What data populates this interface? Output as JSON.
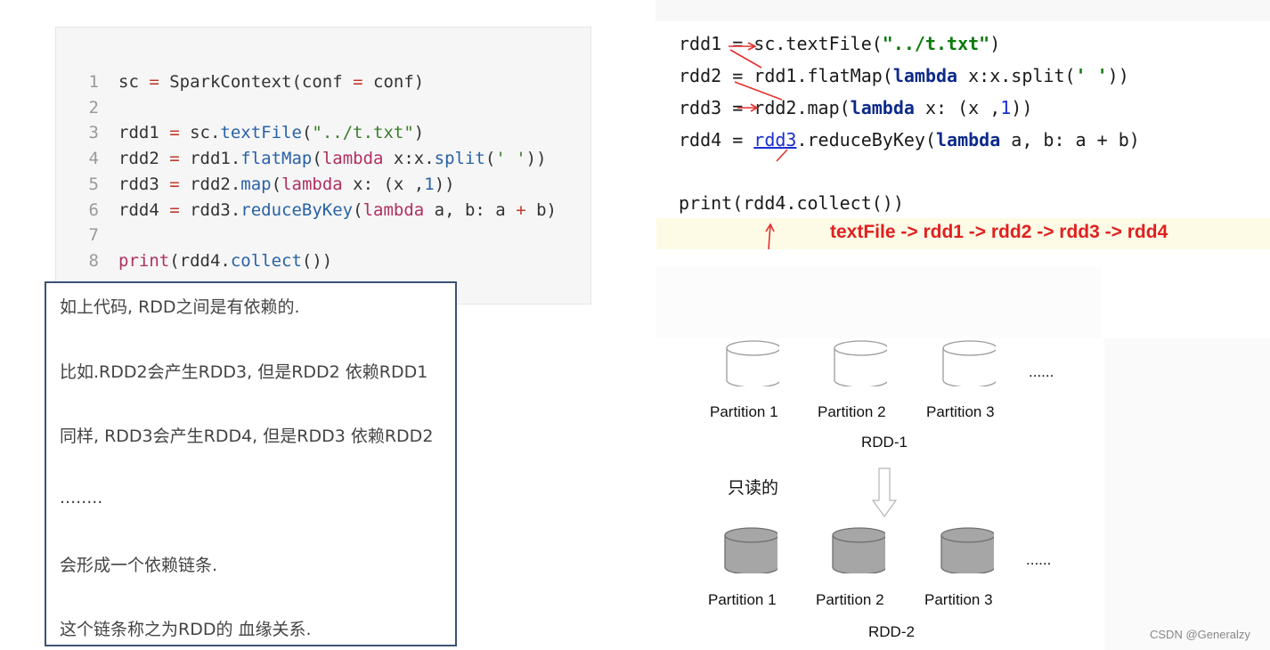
{
  "code_panel": {
    "lines": [
      {
        "num": "1",
        "parts": [
          [
            "tx",
            "sc "
          ],
          [
            "op",
            "="
          ],
          [
            "tx",
            " SparkContext(conf "
          ],
          [
            "op",
            "="
          ],
          [
            "tx",
            " conf)"
          ]
        ]
      },
      {
        "num": "2",
        "parts": []
      },
      {
        "num": "3",
        "parts": [
          [
            "tx",
            "rdd1 "
          ],
          [
            "op",
            "="
          ],
          [
            "tx",
            " sc."
          ],
          [
            "fn",
            "textFile"
          ],
          [
            "tx",
            "("
          ],
          [
            "st",
            "\"../t.txt\""
          ],
          [
            "tx",
            ")"
          ]
        ]
      },
      {
        "num": "4",
        "parts": [
          [
            "tx",
            "rdd2 "
          ],
          [
            "op",
            "="
          ],
          [
            "tx",
            " rdd1."
          ],
          [
            "fn",
            "flatMap"
          ],
          [
            "tx",
            "("
          ],
          [
            "kw",
            "lambda"
          ],
          [
            "tx",
            " x:x."
          ],
          [
            "fn",
            "split"
          ],
          [
            "tx",
            "("
          ],
          [
            "st",
            "' '"
          ],
          [
            "tx",
            "))"
          ]
        ]
      },
      {
        "num": "5",
        "parts": [
          [
            "tx",
            "rdd3 "
          ],
          [
            "op",
            "="
          ],
          [
            "tx",
            " rdd2."
          ],
          [
            "fn",
            "map"
          ],
          [
            "tx",
            "("
          ],
          [
            "kw",
            "lambda"
          ],
          [
            "tx",
            " x: (x ,"
          ],
          [
            "nm",
            "1"
          ],
          [
            "tx",
            "))"
          ]
        ]
      },
      {
        "num": "6",
        "parts": [
          [
            "tx",
            "rdd4 "
          ],
          [
            "op",
            "="
          ],
          [
            "tx",
            " rdd3."
          ],
          [
            "fn",
            "reduceByKey"
          ],
          [
            "tx",
            "("
          ],
          [
            "kw",
            "lambda"
          ],
          [
            "tx",
            " a, b: a "
          ],
          [
            "op",
            "+"
          ],
          [
            "tx",
            " b)"
          ]
        ]
      },
      {
        "num": "7",
        "parts": []
      },
      {
        "num": "8",
        "parts": [
          [
            "kw",
            "print"
          ],
          [
            "tx",
            "(rdd4."
          ],
          [
            "fn",
            "collect"
          ],
          [
            "tx",
            "())"
          ]
        ]
      }
    ]
  },
  "notes": [
    "如上代码, RDD之间是有依赖的.",
    "比如.RDD2会产生RDD3, 但是RDD2 依赖RDD1",
    "同样, RDD3会产生RDD4, 但是RDD3 依赖RDD2",
    "........",
    "会形成一个依赖链条.",
    "这个链条称之为RDD的 血缘关系."
  ],
  "right_code": {
    "lines": [
      [
        [
          "n",
          "rdd1 = sc.textFile("
        ],
        [
          "s",
          "\"../t.txt\""
        ],
        [
          "n",
          ")"
        ]
      ],
      [
        [
          "n",
          "rdd2 = rdd1.flatMap("
        ],
        [
          "k",
          "lambda"
        ],
        [
          "n",
          " x:x.split("
        ],
        [
          "s",
          "' '"
        ],
        [
          "n",
          "))"
        ]
      ],
      [
        [
          "n",
          "rdd3 = rdd2.map("
        ],
        [
          "k",
          "lambda"
        ],
        [
          "n",
          " x: (x ,"
        ],
        [
          "d",
          "1"
        ],
        [
          "n",
          "))"
        ]
      ],
      [
        [
          "n",
          "rdd4 = "
        ],
        [
          "u",
          "rdd3"
        ],
        [
          "n",
          ".reduceByKey("
        ],
        [
          "k",
          "lambda"
        ],
        [
          "n",
          " a, b: a + b)"
        ]
      ],
      [],
      [
        [
          "n",
          "print(rdd4.collect())"
        ]
      ]
    ],
    "chain": "textFile -> rdd1 -> rdd2 -> rdd3 -> rdd4"
  },
  "diagram": {
    "rdd1": {
      "label": "RDD-1",
      "partitions": [
        "Partition 1",
        "Partition 2",
        "Partition 3"
      ],
      "ellipsis": "......",
      "fill": "#ffffff"
    },
    "readonly_label": "只读的",
    "rdd2": {
      "label": "RDD-2",
      "partitions": [
        "Partition 1",
        "Partition 2",
        "Partition 3"
      ],
      "ellipsis": "......",
      "fill": "#a6a6a6"
    }
  },
  "watermark": "CSDN @Generalzy"
}
